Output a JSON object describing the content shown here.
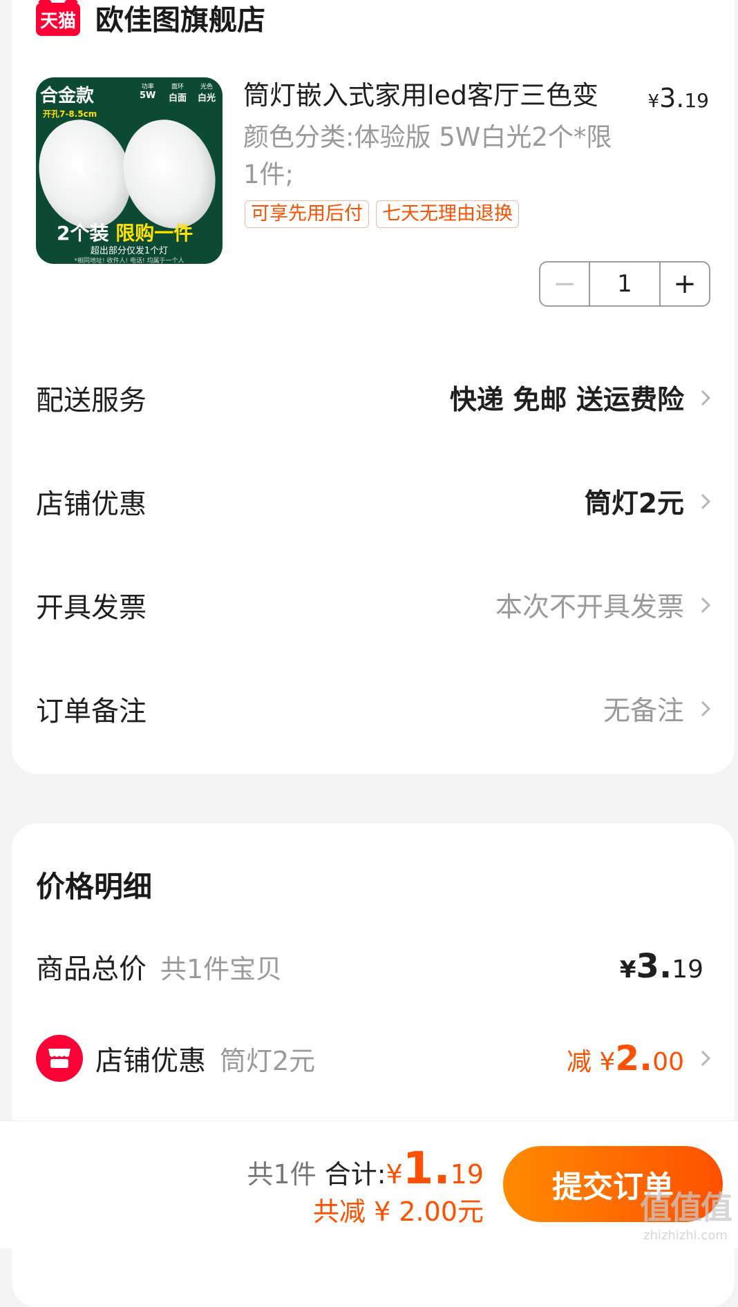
{
  "store": {
    "badge": "天猫",
    "name": "欧佳图旗舰店"
  },
  "product": {
    "image": {
      "title": "合金款",
      "hole": "开孔7-8.5cm",
      "specs": [
        {
          "k": "功率",
          "v": "5W"
        },
        {
          "k": "面环",
          "v": "白面"
        },
        {
          "k": "光色",
          "v": "白光"
        }
      ],
      "pack": "2个装",
      "limit": "限购一件",
      "note": "超出部分仅发1个灯",
      "fine": "*相同地址! 收件人! 电话! 均属于一个人"
    },
    "title": "筒灯嵌入式家用led客厅三色变",
    "price_symbol": "¥",
    "price_int": "3.",
    "price_dec": "19",
    "sku": "颜色分类:体验版 5W白光2个*限1件;",
    "tags": [
      "可享先用后付",
      "七天无理由退换"
    ],
    "quantity": "1"
  },
  "rows": {
    "delivery": {
      "label": "配送服务",
      "value": "快递 免邮 送运费险"
    },
    "discount": {
      "label": "店铺优惠",
      "value": "筒灯2元"
    },
    "invoice": {
      "label": "开具发票",
      "value": "本次不开具发票"
    },
    "note": {
      "label": "订单备注",
      "value": "无备注"
    }
  },
  "price_detail": {
    "title": "价格明细",
    "goods_label": "商品总价",
    "goods_sub": "共1件宝贝",
    "goods_yen": "¥",
    "goods_int": "3.",
    "goods_dec": "19",
    "shop_label": "店铺优惠",
    "shop_sub": "筒灯2元",
    "shop_prefix": "减 ¥",
    "shop_int": "2.",
    "shop_dec": "00"
  },
  "bottom": {
    "count": "共1件",
    "total_label": "合计:",
    "total_yen": "¥",
    "total_int": "1.",
    "total_dec": "19",
    "saved": "共减 ¥ 2.00元",
    "submit": "提交订单"
  },
  "watermark": {
    "main": "值值值",
    "sub": "zhizhizhi.com"
  },
  "colors": {
    "accent": "#ff5000",
    "tmall": "#ff0036",
    "muted": "#9a9a9a"
  }
}
